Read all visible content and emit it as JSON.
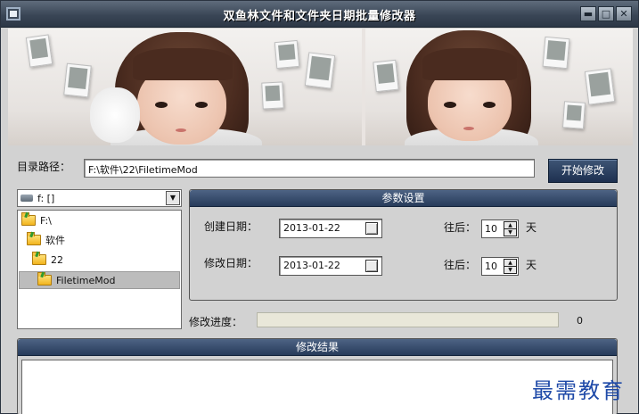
{
  "window": {
    "title": "双鱼林文件和文件夹日期批量修改器",
    "buttons": {
      "minimize": "▬",
      "maximize": "□",
      "close": "✕"
    }
  },
  "banner": {
    "description_icons": [
      "girl-photo-left",
      "girl-photo-right"
    ]
  },
  "path": {
    "label": "目录路径：",
    "value": "F:\\软件\\22\\FiletimeMod",
    "start_button": "开始修改"
  },
  "drive_select": {
    "value": "f: []",
    "icon": "drive-icon"
  },
  "tree": {
    "items": [
      {
        "label": "F:\\",
        "depth": 0,
        "selected": false
      },
      {
        "label": "软件",
        "depth": 1,
        "selected": false
      },
      {
        "label": "22",
        "depth": 2,
        "selected": false
      },
      {
        "label": "FiletimeMod",
        "depth": 3,
        "selected": true
      }
    ]
  },
  "params": {
    "title": "参数设置",
    "create_date_label": "创建日期：",
    "create_date_value": "2013-01-22",
    "modify_date_label": "修改日期：",
    "modify_date_value": "2013-01-22",
    "offset_label": "往后：",
    "create_offset": "10",
    "modify_offset": "10",
    "unit": "天"
  },
  "progress": {
    "label": "修改进度：",
    "value": 0,
    "text": "0"
  },
  "result": {
    "title": "修改结果"
  },
  "watermark": "最需教育",
  "colors": {
    "panel_header": "#273b5a",
    "button": "#1d3050",
    "window_bg": "#d2d2d2"
  }
}
